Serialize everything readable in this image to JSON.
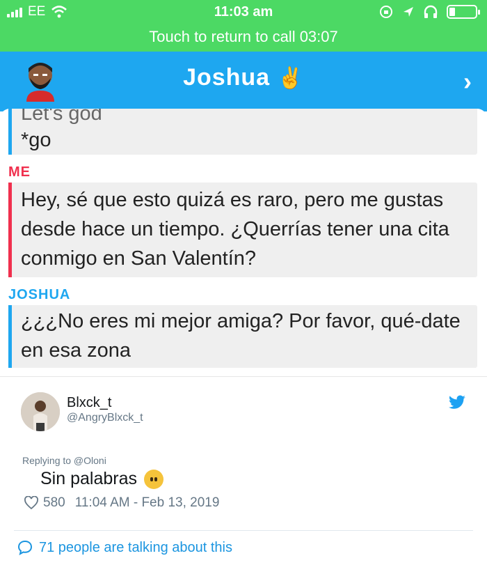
{
  "status_bar": {
    "carrier": "EE",
    "time": "11:03 am"
  },
  "call_banner": {
    "text": "Touch to return to call 03:07"
  },
  "chat": {
    "title": "Joshua",
    "title_emoji": "✌",
    "messages": [
      {
        "sender": "",
        "lines": [
          "Let's god",
          "*go"
        ],
        "accent": "#1ea7f0"
      },
      {
        "sender": "ME",
        "text": "Hey, sé que esto quizá es raro, pero me gustas desde hace un tiempo. ¿Querrías tener una cita conmigo en San Valentín?",
        "accent": "#f0304e"
      },
      {
        "sender": "JOSHUA",
        "text": "¿¿¿No eres mi mejor amiga? Por favor, qué-date en esa zona",
        "accent": "#1ea7f0"
      }
    ]
  },
  "tweet": {
    "display_name": "Blxck_t",
    "handle": "@AngryBlxck_t",
    "replying_to": "Replying to @Oloni",
    "text": "Sin palabras",
    "likes": "580",
    "timestamp": "11:04 AM - Feb 13, 2019",
    "talking": "71 people are talking about this"
  },
  "colors": {
    "status_green": "#4cd964",
    "snap_blue": "#1ea7f0",
    "me_red": "#f0304e",
    "twitter_blue": "#1b95e0"
  }
}
